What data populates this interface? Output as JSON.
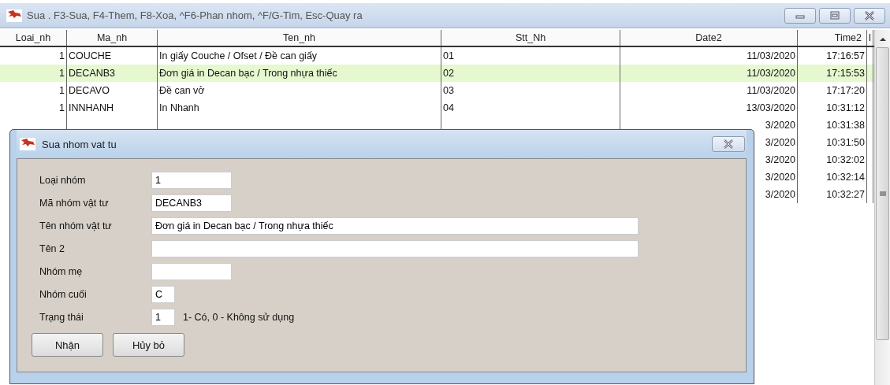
{
  "window": {
    "title": "Sua  . F3-Sua, F4-Them, F8-Xoa, ^F6-Phan nhom, ^F/G-Tim, Esc-Quay ra"
  },
  "table": {
    "columns": [
      "Loai_nh",
      "Ma_nh",
      "Ten_nh",
      "Stt_Nh",
      "Date2",
      "Time2",
      "I"
    ],
    "rows": [
      {
        "selected": false,
        "cells": [
          "1",
          "COUCHE",
          "In giấy Couche / Ofset / Đề can giấy",
          "01",
          "11/03/2020",
          "17:16:57"
        ]
      },
      {
        "selected": true,
        "cells": [
          "1",
          "DECANB3",
          "Đơn giá in Decan bạc / Trong nhựa thiếc",
          "02",
          "11/03/2020",
          "17:15:53"
        ]
      },
      {
        "selected": false,
        "cells": [
          "1",
          "DECAVO",
          "Đề can vở",
          "03",
          "11/03/2020",
          "17:17:20"
        ]
      },
      {
        "selected": false,
        "cells": [
          "1",
          "INNHANH",
          "In Nhanh",
          "04",
          "13/03/2020",
          "10:31:12"
        ]
      },
      {
        "selected": false,
        "cells": [
          null,
          null,
          null,
          null,
          "3/2020",
          "10:31:38"
        ]
      },
      {
        "selected": false,
        "cells": [
          null,
          null,
          null,
          null,
          "3/2020",
          "10:31:50"
        ]
      },
      {
        "selected": false,
        "cells": [
          null,
          null,
          null,
          null,
          "3/2020",
          "10:32:02"
        ]
      },
      {
        "selected": false,
        "cells": [
          null,
          null,
          null,
          null,
          "3/2020",
          "10:32:14"
        ]
      },
      {
        "selected": false,
        "cells": [
          null,
          null,
          null,
          null,
          "3/2020",
          "10:32:27"
        ]
      }
    ]
  },
  "dialog": {
    "title": "Sua nhom vat tu",
    "fields": [
      {
        "label": "Loại nhóm",
        "value": "1",
        "kind": "short"
      },
      {
        "label": "Mã nhóm vật tư",
        "value": "DECANB3",
        "kind": "short"
      },
      {
        "label": "Tên nhóm vật tư",
        "value": "Đơn giá in Decan bạc / Trong nhựa thiếc",
        "kind": "wide"
      },
      {
        "label": "Tên 2",
        "kind": "wide"
      },
      {
        "label": "Nhóm mẹ",
        "kind": "short"
      },
      {
        "label": "Nhóm cuối",
        "value": "C",
        "kind": "narrow"
      },
      {
        "label": "Trạng thái",
        "value": "1",
        "kind": "narrow",
        "note": "1- Có, 0 - Không sử dụng"
      }
    ],
    "buttons": [
      "Nhận",
      "Hủy bỏ"
    ]
  }
}
